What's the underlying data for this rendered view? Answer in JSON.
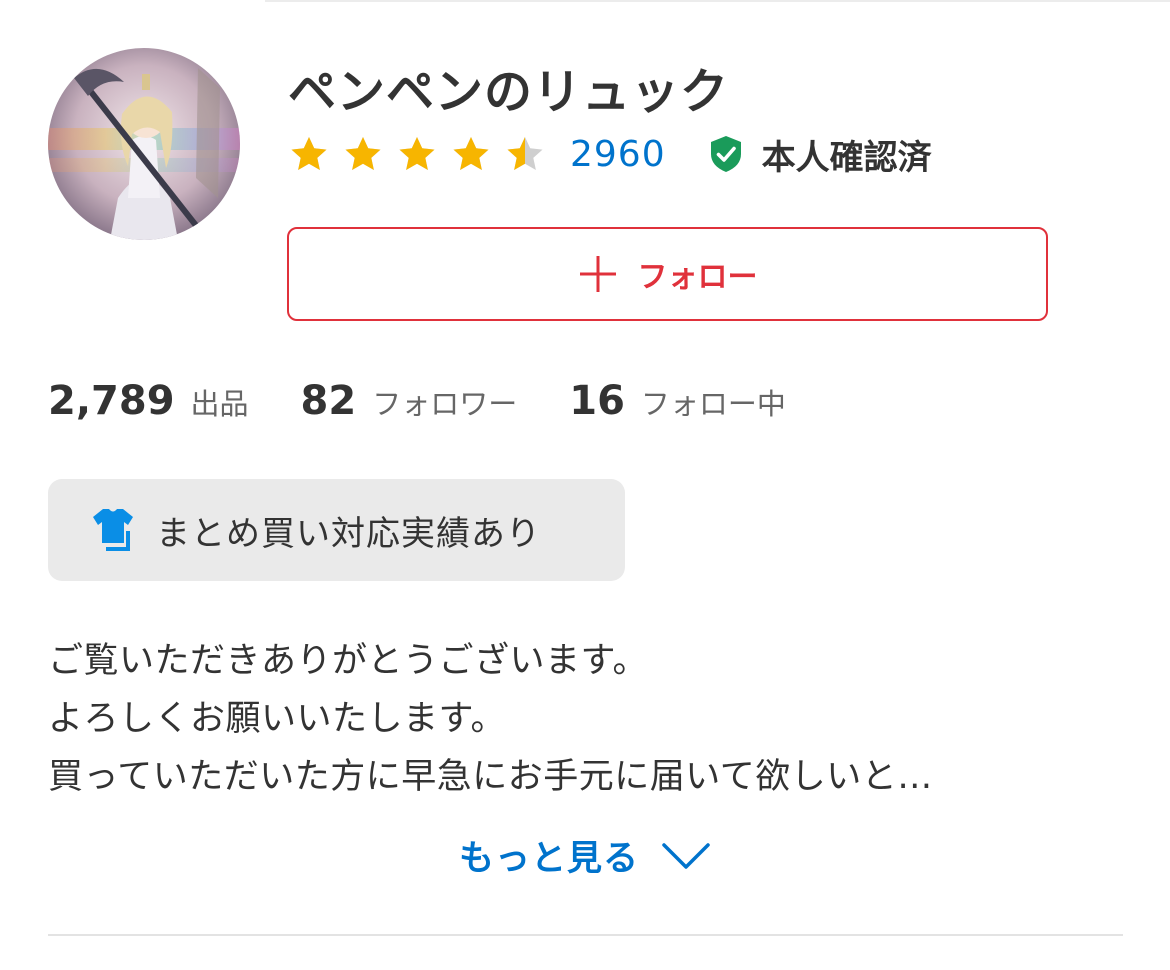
{
  "shop": {
    "name": "ペンペンのリュック",
    "rating": 4.5,
    "rating_max": 5,
    "review_count": "2960",
    "verified_label": "本人確認済",
    "verified_icon": "shield-check-icon"
  },
  "follow_button": {
    "label": "フォロー",
    "icon": "plus-icon"
  },
  "stats": [
    {
      "value": "2,789",
      "label": "出品"
    },
    {
      "value": "82",
      "label": "フォロワー"
    },
    {
      "value": "16",
      "label": "フォロー中"
    }
  ],
  "bulk_badge": {
    "icon": "shirt-icon",
    "label": "まとめ買い対応実績あり"
  },
  "bio": {
    "lines": [
      "ご覧いただきありがとうございます。",
      "よろしくお願いいたします。",
      "買っていただいた方に早急にお手元に届いて欲しいと…"
    ]
  },
  "more_link": {
    "label": "もっと見る",
    "icon": "chevron-down-icon"
  },
  "colors": {
    "accent_red": "#e0313b",
    "link_blue": "#0073cc",
    "star_gold": "#f7b500",
    "star_gray": "#cfcfcf",
    "verified_green": "#1a9b5a"
  }
}
